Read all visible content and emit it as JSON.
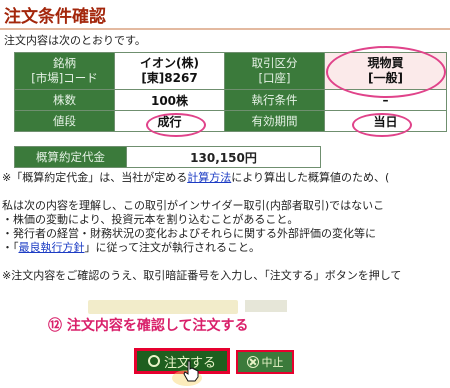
{
  "title": "注文条件確認",
  "intro": "注文内容は次のとおりです。",
  "table": {
    "brand_header": "銘柄\n[市場]コード",
    "brand_value": "イオン(株)\n[東]8267",
    "account_header": "取引区分\n[口座]",
    "account_value": "現物買\n[一般]",
    "shares_header": "株数",
    "shares_value": "100株",
    "condition_header": "執行条件",
    "condition_value": "–",
    "price_header": "値段",
    "price_value": "成行",
    "period_header": "有効期間",
    "period_value": "当日",
    "estimate_header": "概算約定代金",
    "estimate_value": "130,150円"
  },
  "notes": {
    "n1_prefix": "※「概算約定代金」は、当社が定める",
    "n1_link": "計算方法",
    "n1_suffix": "により算出した概算値のため、(",
    "p2_l1": "私は次の内容を理解し、この取引がインサイダー取引(内部者取引)ではないこ",
    "p2_l2": "・株価の変動により、投資元本を割り込むことがあること。",
    "p2_l3": "・発行者の経営・財務状況の変化およびそれらに関する外部評価の変化等に",
    "p2_l4_prefix": "・「",
    "p2_l4_link": "最良執行方針",
    "p2_l4_suffix": "」に従って注文が執行されること。",
    "confirm": "※注文内容をご確認のうえ、取引暗証番号を入力し、「注文する」ボタンを押して"
  },
  "callout": "⑫ 注文内容を確認して注文する",
  "buttons": {
    "order": "注文する",
    "cancel": "中止"
  },
  "colors": {
    "title": "#a3260b",
    "header_green": "#3b7a3b",
    "highlight_pink": "#e0438a",
    "button_border_red": "#e6002e",
    "link_blue": "#1c3cc4"
  }
}
